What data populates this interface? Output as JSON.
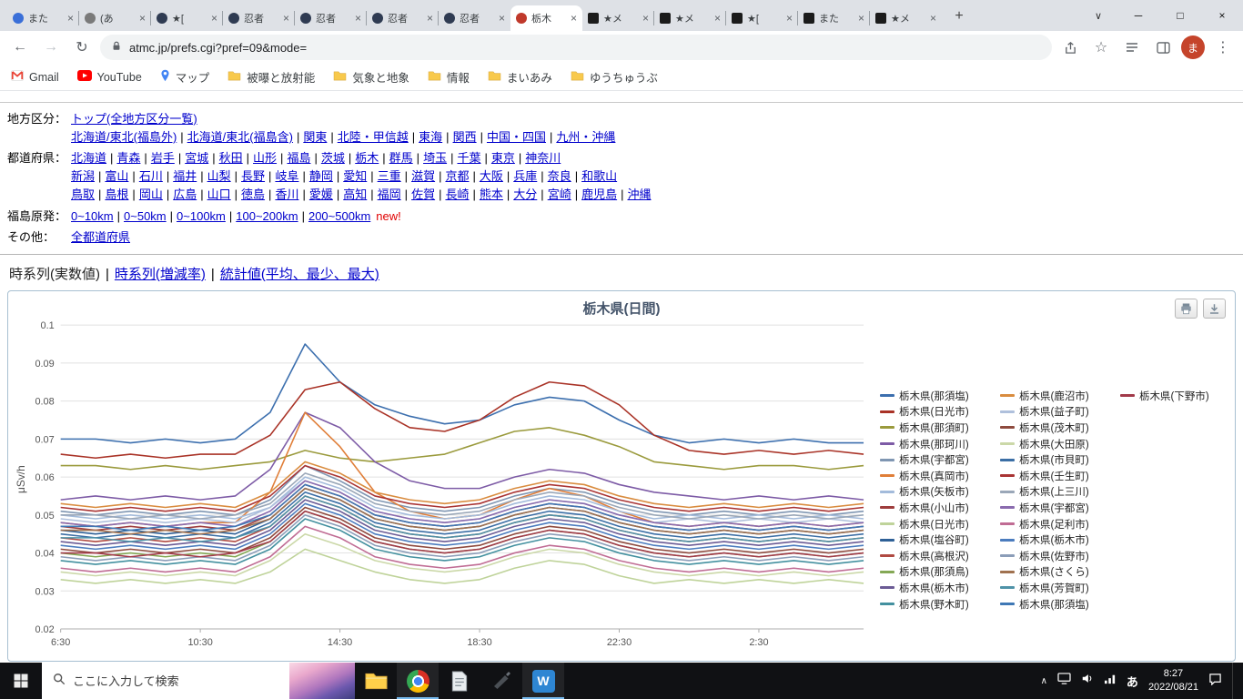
{
  "glyphs": {
    "close": "×",
    "new_tab": "+",
    "caret": "∨",
    "minimize": "─",
    "maximize": "□",
    "back": "←",
    "forward": "→",
    "reload": "↻",
    "star": "☆",
    "kebab": "⋮",
    "tray_chevron": "∧"
  },
  "browser": {
    "tabs": [
      {
        "title": "また",
        "favicon": "circle-blue"
      },
      {
        "title": "(あ",
        "favicon": "circle-gray"
      },
      {
        "title": "★[",
        "favicon": "circle-dark"
      },
      {
        "title": "忍者",
        "favicon": "circle-dark"
      },
      {
        "title": "忍者",
        "favicon": "circle-dark"
      },
      {
        "title": "忍者",
        "favicon": "circle-dark"
      },
      {
        "title": "忍者",
        "favicon": "circle-dark"
      },
      {
        "title": "栃木",
        "favicon": "circle-red",
        "active": true
      },
      {
        "title": "★メ",
        "favicon": "square-dark"
      },
      {
        "title": "★メ",
        "favicon": "square-dark"
      },
      {
        "title": "★[",
        "favicon": "square-dark"
      },
      {
        "title": "また",
        "favicon": "square-dark"
      },
      {
        "title": "★メ",
        "favicon": "square-dark"
      }
    ],
    "nav": {
      "url": "atmc.jp/prefs.cgi?pref=09&mode="
    },
    "avatar_label": "ま",
    "bookmarks": [
      {
        "label": "Gmail",
        "icon": "gmail"
      },
      {
        "label": "YouTube",
        "icon": "youtube"
      },
      {
        "label": "マップ",
        "icon": "map"
      },
      {
        "label": "被曝と放射能",
        "icon": "folder"
      },
      {
        "label": "気象と地象",
        "icon": "folder"
      },
      {
        "label": "情報",
        "icon": "folder"
      },
      {
        "label": "まいあみ",
        "icon": "folder"
      },
      {
        "label": "ゆうちゅうぶ",
        "icon": "folder"
      }
    ]
  },
  "page": {
    "separator": "|",
    "nav_sections": [
      {
        "label": "地方区分：",
        "lines": [
          [
            "トップ(全地方区分一覧)"
          ],
          [
            "北海道/東北(福島外)",
            "北海道/東北(福島含)",
            "関東",
            "北陸・甲信越",
            "東海",
            "関西",
            "中国・四国",
            "九州・沖縄"
          ]
        ]
      },
      {
        "label": "都道府県：",
        "lines": [
          [
            "北海道",
            "青森",
            "岩手",
            "宮城",
            "秋田",
            "山形",
            "福島",
            "茨城",
            "栃木",
            "群馬",
            "埼玉",
            "千葉",
            "東京",
            "神奈川"
          ],
          [
            "新潟",
            "富山",
            "石川",
            "福井",
            "山梨",
            "長野",
            "岐阜",
            "静岡",
            "愛知",
            "三重",
            "滋賀",
            "京都",
            "大阪",
            "兵庫",
            "奈良",
            "和歌山"
          ],
          [
            "鳥取",
            "島根",
            "岡山",
            "広島",
            "山口",
            "徳島",
            "香川",
            "愛媛",
            "高知",
            "福岡",
            "佐賀",
            "長崎",
            "熊本",
            "大分",
            "宮崎",
            "鹿児島",
            "沖縄"
          ]
        ]
      },
      {
        "label": "福島原発：",
        "gap_top": true,
        "suffix": "new!",
        "lines": [
          [
            "0~10km",
            "0~50km",
            "0~100km",
            "100~200km",
            "200~500km"
          ]
        ]
      },
      {
        "label": "その他：",
        "lines": [
          [
            "全都道府県"
          ]
        ]
      }
    ],
    "series_tabs": [
      {
        "label": "時系列(実数値)",
        "current": true
      },
      {
        "label": "時系列(増減率)",
        "current": false
      },
      {
        "label": "統計値(平均、最少、最大)",
        "current": false
      }
    ]
  },
  "chart_data": {
    "type": "line",
    "title": "栃木県(日間)",
    "ylabel": "μSv/h",
    "ylim": [
      0.02,
      0.1
    ],
    "ytick_step": 0.01,
    "grid": "horizontal",
    "legend_position": "right",
    "legend_rows_per_column": 14,
    "x": [
      "6:30",
      "7:30",
      "8:30",
      "9:30",
      "10:30",
      "11:30",
      "12:30",
      "13:30",
      "14:30",
      "15:30",
      "16:30",
      "17:30",
      "18:30",
      "19:30",
      "20:30",
      "21:30",
      "22:30",
      "23:30",
      "0:30",
      "1:30",
      "2:30",
      "3:30",
      "4:30",
      "5:30"
    ],
    "x_tick_indices": [
      0,
      4,
      8,
      12,
      16,
      20
    ],
    "x_tick_labels": [
      "6:30",
      "10:30",
      "14:30",
      "18:30",
      "22:30",
      "2:30"
    ],
    "series": [
      {
        "name": "栃木県(那須塩)",
        "color": "#3C6FAE",
        "values": [
          0.07,
          0.07,
          0.069,
          0.07,
          0.069,
          0.07,
          0.077,
          0.095,
          0.085,
          0.079,
          0.076,
          0.074,
          0.075,
          0.079,
          0.081,
          0.08,
          0.075,
          0.071,
          0.069,
          0.07,
          0.069,
          0.07,
          0.069,
          0.069
        ]
      },
      {
        "name": "栃木県(日光市)",
        "color": "#A93226",
        "values": [
          0.066,
          0.065,
          0.066,
          0.065,
          0.066,
          0.066,
          0.071,
          0.083,
          0.085,
          0.078,
          0.073,
          0.072,
          0.075,
          0.081,
          0.085,
          0.084,
          0.079,
          0.071,
          0.067,
          0.066,
          0.067,
          0.066,
          0.067,
          0.066
        ]
      },
      {
        "name": "栃木県(那須町)",
        "color": "#9A9A3C",
        "values": [
          0.063,
          0.063,
          0.062,
          0.063,
          0.062,
          0.063,
          0.064,
          0.067,
          0.065,
          0.064,
          0.065,
          0.066,
          0.069,
          0.072,
          0.073,
          0.071,
          0.068,
          0.064,
          0.063,
          0.062,
          0.063,
          0.063,
          0.062,
          0.063
        ]
      },
      {
        "name": "栃木県(那珂川)",
        "color": "#7D5BA6",
        "values": [
          0.054,
          0.055,
          0.054,
          0.055,
          0.054,
          0.055,
          0.062,
          0.077,
          0.073,
          0.064,
          0.059,
          0.057,
          0.057,
          0.06,
          0.062,
          0.061,
          0.058,
          0.056,
          0.055,
          0.054,
          0.055,
          0.054,
          0.055,
          0.054
        ]
      },
      {
        "name": "栃木県(宇都宮)",
        "color": "#7F96B2",
        "values": [
          0.051,
          0.05,
          0.051,
          0.05,
          0.051,
          0.05,
          0.054,
          0.063,
          0.059,
          0.054,
          0.052,
          0.051,
          0.052,
          0.055,
          0.057,
          0.056,
          0.053,
          0.051,
          0.05,
          0.051,
          0.05,
          0.051,
          0.05,
          0.051
        ]
      },
      {
        "name": "栃木県(真岡市)",
        "color": "#E07E38",
        "values": [
          0.048,
          0.047,
          0.048,
          0.047,
          0.048,
          0.048,
          0.056,
          0.077,
          0.068,
          0.056,
          0.051,
          0.049,
          0.05,
          0.054,
          0.057,
          0.055,
          0.051,
          0.048,
          0.047,
          0.048,
          0.047,
          0.048,
          0.047,
          0.048
        ]
      },
      {
        "name": "栃木県(矢板市)",
        "color": "#A3BBDB",
        "values": [
          0.05,
          0.049,
          0.05,
          0.049,
          0.05,
          0.049,
          0.052,
          0.06,
          0.057,
          0.052,
          0.05,
          0.049,
          0.05,
          0.053,
          0.055,
          0.054,
          0.051,
          0.049,
          0.05,
          0.049,
          0.05,
          0.049,
          0.05,
          0.049
        ]
      },
      {
        "name": "栃木県(小山市)",
        "color": "#9E3D3D",
        "values": [
          0.047,
          0.046,
          0.047,
          0.046,
          0.047,
          0.046,
          0.05,
          0.058,
          0.055,
          0.05,
          0.048,
          0.047,
          0.048,
          0.051,
          0.053,
          0.052,
          0.049,
          0.047,
          0.046,
          0.047,
          0.046,
          0.047,
          0.046,
          0.047
        ]
      },
      {
        "name": "栃木県(日光市)",
        "color": "#BFD39A",
        "values": [
          0.033,
          0.032,
          0.033,
          0.032,
          0.033,
          0.032,
          0.035,
          0.041,
          0.038,
          0.035,
          0.033,
          0.032,
          0.033,
          0.036,
          0.038,
          0.037,
          0.034,
          0.032,
          0.033,
          0.032,
          0.033,
          0.032,
          0.033,
          0.032
        ]
      },
      {
        "name": "栃木県(塩谷町)",
        "color": "#2E6096",
        "values": [
          0.046,
          0.045,
          0.046,
          0.045,
          0.046,
          0.045,
          0.049,
          0.057,
          0.054,
          0.049,
          0.047,
          0.046,
          0.047,
          0.05,
          0.052,
          0.051,
          0.048,
          0.046,
          0.045,
          0.046,
          0.045,
          0.046,
          0.045,
          0.046
        ]
      },
      {
        "name": "栃木県(高根沢)",
        "color": "#B04A42",
        "values": [
          0.044,
          0.043,
          0.044,
          0.043,
          0.044,
          0.043,
          0.047,
          0.055,
          0.052,
          0.047,
          0.045,
          0.044,
          0.045,
          0.048,
          0.05,
          0.049,
          0.046,
          0.044,
          0.043,
          0.044,
          0.043,
          0.044,
          0.043,
          0.044
        ]
      },
      {
        "name": "栃木県(那須鳥)",
        "color": "#84A855",
        "values": [
          0.04,
          0.039,
          0.04,
          0.039,
          0.04,
          0.039,
          0.043,
          0.051,
          0.048,
          0.043,
          0.041,
          0.04,
          0.041,
          0.044,
          0.046,
          0.045,
          0.042,
          0.04,
          0.039,
          0.04,
          0.039,
          0.04,
          0.039,
          0.04
        ]
      },
      {
        "name": "栃木県(栃木市)",
        "color": "#6B5B95",
        "values": [
          0.043,
          0.042,
          0.043,
          0.042,
          0.043,
          0.042,
          0.046,
          0.054,
          0.051,
          0.046,
          0.044,
          0.043,
          0.044,
          0.047,
          0.049,
          0.048,
          0.045,
          0.043,
          0.042,
          0.043,
          0.042,
          0.043,
          0.042,
          0.043
        ]
      },
      {
        "name": "栃木県(野木町)",
        "color": "#43909F",
        "values": [
          0.038,
          0.037,
          0.038,
          0.037,
          0.038,
          0.037,
          0.041,
          0.049,
          0.046,
          0.041,
          0.039,
          0.038,
          0.039,
          0.042,
          0.044,
          0.043,
          0.04,
          0.038,
          0.037,
          0.038,
          0.037,
          0.038,
          0.037,
          0.038
        ]
      },
      {
        "name": "栃木県(鹿沼市)",
        "color": "#D98C3F",
        "values": [
          0.053,
          0.052,
          0.053,
          0.052,
          0.053,
          0.052,
          0.056,
          0.064,
          0.061,
          0.056,
          0.054,
          0.053,
          0.054,
          0.057,
          0.059,
          0.058,
          0.055,
          0.053,
          0.052,
          0.053,
          0.052,
          0.053,
          0.052,
          0.053
        ]
      },
      {
        "name": "栃木県(益子町)",
        "color": "#AFC0DC",
        "values": [
          0.049,
          0.048,
          0.049,
          0.048,
          0.049,
          0.048,
          0.052,
          0.059,
          0.056,
          0.051,
          0.049,
          0.048,
          0.049,
          0.052,
          0.054,
          0.053,
          0.05,
          0.048,
          0.049,
          0.048,
          0.049,
          0.048,
          0.049,
          0.048
        ]
      },
      {
        "name": "栃木県(茂木町)",
        "color": "#8E4A3E",
        "values": [
          0.041,
          0.04,
          0.041,
          0.04,
          0.041,
          0.04,
          0.044,
          0.052,
          0.049,
          0.044,
          0.042,
          0.041,
          0.042,
          0.045,
          0.047,
          0.046,
          0.043,
          0.041,
          0.04,
          0.041,
          0.04,
          0.041,
          0.04,
          0.041
        ]
      },
      {
        "name": "栃木県(大田原)",
        "color": "#CBD8A8",
        "values": [
          0.035,
          0.034,
          0.035,
          0.034,
          0.035,
          0.034,
          0.038,
          0.045,
          0.042,
          0.038,
          0.036,
          0.035,
          0.036,
          0.039,
          0.041,
          0.04,
          0.037,
          0.035,
          0.034,
          0.035,
          0.034,
          0.035,
          0.034,
          0.035
        ]
      },
      {
        "name": "栃木県(市貝町)",
        "color": "#3B6EA5",
        "values": [
          0.045,
          0.044,
          0.045,
          0.044,
          0.045,
          0.044,
          0.048,
          0.056,
          0.053,
          0.048,
          0.046,
          0.045,
          0.046,
          0.049,
          0.051,
          0.05,
          0.047,
          0.045,
          0.044,
          0.045,
          0.044,
          0.045,
          0.044,
          0.045
        ]
      },
      {
        "name": "栃木県(壬生町)",
        "color": "#A93434",
        "values": [
          0.052,
          0.051,
          0.052,
          0.051,
          0.052,
          0.051,
          0.055,
          0.063,
          0.06,
          0.055,
          0.053,
          0.052,
          0.053,
          0.056,
          0.058,
          0.057,
          0.054,
          0.052,
          0.051,
          0.052,
          0.051,
          0.052,
          0.051,
          0.052
        ]
      },
      {
        "name": "栃木県(上三川)",
        "color": "#9AA7B8",
        "values": [
          0.05,
          0.05,
          0.049,
          0.05,
          0.049,
          0.05,
          0.053,
          0.061,
          0.058,
          0.053,
          0.051,
          0.05,
          0.051,
          0.054,
          0.056,
          0.055,
          0.052,
          0.05,
          0.049,
          0.05,
          0.049,
          0.05,
          0.049,
          0.05
        ]
      },
      {
        "name": "栃木県(宇都宮)",
        "color": "#8A6BAE",
        "values": [
          0.048,
          0.047,
          0.048,
          0.047,
          0.048,
          0.047,
          0.051,
          0.059,
          0.056,
          0.051,
          0.049,
          0.048,
          0.049,
          0.052,
          0.054,
          0.053,
          0.05,
          0.048,
          0.047,
          0.048,
          0.047,
          0.048,
          0.047,
          0.048
        ]
      },
      {
        "name": "栃木県(足利市)",
        "color": "#C06C94",
        "values": [
          0.036,
          0.035,
          0.036,
          0.035,
          0.036,
          0.035,
          0.039,
          0.047,
          0.044,
          0.039,
          0.037,
          0.036,
          0.037,
          0.04,
          0.042,
          0.041,
          0.038,
          0.036,
          0.035,
          0.036,
          0.035,
          0.036,
          0.035,
          0.036
        ]
      },
      {
        "name": "栃木県(栃木市)",
        "color": "#4B7CBE",
        "values": [
          0.042,
          0.041,
          0.042,
          0.041,
          0.042,
          0.041,
          0.045,
          0.053,
          0.05,
          0.045,
          0.043,
          0.042,
          0.043,
          0.046,
          0.048,
          0.047,
          0.044,
          0.042,
          0.041,
          0.042,
          0.041,
          0.042,
          0.041,
          0.042
        ]
      },
      {
        "name": "栃木県(佐野市)",
        "color": "#8B9DB8",
        "values": [
          0.039,
          0.038,
          0.039,
          0.038,
          0.039,
          0.038,
          0.042,
          0.05,
          0.047,
          0.042,
          0.04,
          0.039,
          0.04,
          0.043,
          0.045,
          0.044,
          0.041,
          0.039,
          0.038,
          0.039,
          0.038,
          0.039,
          0.038,
          0.039
        ]
      },
      {
        "name": "栃木県(さくら)",
        "color": "#A0714F",
        "values": [
          0.046,
          0.046,
          0.045,
          0.046,
          0.045,
          0.046,
          0.049,
          0.057,
          0.054,
          0.049,
          0.047,
          0.046,
          0.047,
          0.05,
          0.052,
          0.051,
          0.048,
          0.046,
          0.045,
          0.046,
          0.045,
          0.046,
          0.045,
          0.046
        ]
      },
      {
        "name": "栃木県(芳賀町)",
        "color": "#4F93A8",
        "values": [
          0.044,
          0.044,
          0.043,
          0.044,
          0.043,
          0.044,
          0.047,
          0.055,
          0.052,
          0.047,
          0.045,
          0.044,
          0.045,
          0.048,
          0.05,
          0.049,
          0.046,
          0.044,
          0.043,
          0.044,
          0.043,
          0.044,
          0.043,
          0.044
        ]
      },
      {
        "name": "栃木県(那須塩)",
        "color": "#3F78B5",
        "values": [
          0.047,
          0.047,
          0.046,
          0.047,
          0.046,
          0.047,
          0.05,
          0.058,
          0.055,
          0.05,
          0.048,
          0.047,
          0.048,
          0.051,
          0.053,
          0.052,
          0.049,
          0.047,
          0.046,
          0.047,
          0.046,
          0.047,
          0.046,
          0.047
        ]
      },
      {
        "name": "栃木県(下野市)",
        "color": "#A23A4A",
        "values": [
          0.04,
          0.04,
          0.039,
          0.04,
          0.039,
          0.04,
          0.043,
          0.051,
          0.048,
          0.043,
          0.041,
          0.04,
          0.041,
          0.044,
          0.046,
          0.045,
          0.042,
          0.04,
          0.039,
          0.04,
          0.039,
          0.04,
          0.039,
          0.04
        ]
      }
    ]
  },
  "taskbar": {
    "search_placeholder": "ここに入力して検索",
    "ime": "あ",
    "clock_time": "8:27",
    "clock_date": "2022/08/21",
    "word_glyph": "W"
  }
}
